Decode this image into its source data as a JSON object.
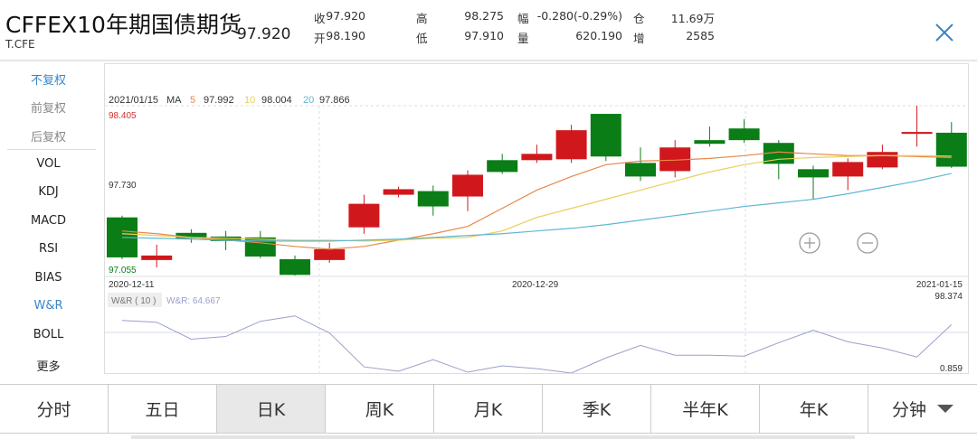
{
  "header": {
    "title": "CFFEX10年期国债期货",
    "code": "T.CFE",
    "last": "97.920",
    "quotes": [
      {
        "label": "收",
        "value": "97.920"
      },
      {
        "label": "高",
        "value": "98.275"
      },
      {
        "label": "幅",
        "value": "-0.280(-0.29%)"
      },
      {
        "label": "仓",
        "value": "11.69万"
      },
      {
        "label": "开",
        "value": "98.190"
      },
      {
        "label": "低",
        "value": "97.910"
      },
      {
        "label": "量",
        "value": "620.190"
      },
      {
        "label": "增",
        "value": "2585"
      }
    ]
  },
  "sidebar": {
    "items": [
      {
        "label": "不复权",
        "state": "active"
      },
      {
        "label": "前复权",
        "state": "gray"
      },
      {
        "label": "后复权",
        "state": "gray"
      },
      {
        "label": "VOL"
      },
      {
        "label": "KDJ"
      },
      {
        "label": "MACD"
      },
      {
        "label": "RSI"
      },
      {
        "label": "BIAS"
      },
      {
        "label": "W&R",
        "state": "active"
      },
      {
        "label": "BOLL"
      },
      {
        "label": "更多"
      }
    ]
  },
  "tabs": [
    {
      "label": "分时"
    },
    {
      "label": "五日"
    },
    {
      "label": "日K",
      "selected": true
    },
    {
      "label": "周K"
    },
    {
      "label": "月K"
    },
    {
      "label": "季K"
    },
    {
      "label": "半年K"
    },
    {
      "label": "年K"
    },
    {
      "label": "分钟",
      "dropdown": true
    }
  ],
  "colors": {
    "up": "#d0181c",
    "down": "#0b7d16",
    "ma5": "#e8884a",
    "ma10": "#e8cf5a",
    "ma20": "#5fb6d6",
    "wr": "#9aa0c8",
    "accent": "#3a86c8"
  },
  "chart_data": {
    "type": "candlestick",
    "legend": {
      "date": "2021/01/15",
      "ma_label": "MA",
      "ma5_label": "5",
      "ma5_value": "97.992",
      "ma10_label": "10",
      "ma10_value": "98.004",
      "ma20_label": "20",
      "ma20_value": "97.866"
    },
    "price_labels": {
      "max": "98.405",
      "mid": "97.730",
      "min": "97.055"
    },
    "ylim": [
      97.055,
      98.405
    ],
    "x_labels": [
      "2020-12-11",
      "2020-12-29",
      "2021-01-15"
    ],
    "candles": [
      [
        97.517,
        97.531,
        97.185,
        97.199
      ],
      [
        97.178,
        97.3,
        97.12,
        97.214
      ],
      [
        97.394,
        97.423,
        97.315,
        97.351
      ],
      [
        97.365,
        97.409,
        97.257,
        97.329
      ],
      [
        97.358,
        97.409,
        97.192,
        97.206
      ],
      [
        97.185,
        97.214,
        97.055,
        97.06
      ],
      [
        97.178,
        97.315,
        97.156,
        97.264
      ],
      [
        97.438,
        97.697,
        97.387,
        97.625
      ],
      [
        97.697,
        97.762,
        97.676,
        97.741
      ],
      [
        97.726,
        97.77,
        97.531,
        97.604
      ],
      [
        97.683,
        97.892,
        97.567,
        97.856
      ],
      [
        97.972,
        98.022,
        97.863,
        97.878
      ],
      [
        97.972,
        98.095,
        97.95,
        98.022
      ],
      [
        97.979,
        98.253,
        97.95,
        98.21
      ],
      [
        98.34,
        98.34,
        97.965,
        98.001
      ],
      [
        97.95,
        98.073,
        97.806,
        97.842
      ],
      [
        97.885,
        98.131,
        97.835,
        98.073
      ],
      [
        98.131,
        98.239,
        98.08,
        98.102
      ],
      [
        98.224,
        98.297,
        98.109,
        98.131
      ],
      [
        98.109,
        98.131,
        97.82,
        97.943
      ],
      [
        97.9,
        97.928,
        97.661,
        97.835
      ],
      [
        97.842,
        97.986,
        97.734,
        97.957
      ],
      [
        97.914,
        98.095,
        97.9,
        98.037
      ],
      [
        98.181,
        98.405,
        98.08,
        98.196
      ],
      [
        98.19,
        98.275,
        97.91,
        97.92
      ]
    ],
    "ma5": [
      97.409,
      97.387,
      97.358,
      97.336,
      97.315,
      97.286,
      97.264,
      97.286,
      97.336,
      97.387,
      97.445,
      97.589,
      97.734,
      97.842,
      97.936,
      97.965,
      97.972,
      97.986,
      98.008,
      98.037,
      98.022,
      98.008,
      98.008,
      98.001,
      97.992
    ],
    "ma10": [
      97.387,
      97.373,
      97.358,
      97.351,
      97.344,
      97.336,
      97.336,
      97.329,
      97.336,
      97.351,
      97.358,
      97.409,
      97.517,
      97.589,
      97.661,
      97.734,
      97.806,
      97.878,
      97.936,
      97.979,
      97.993,
      98.001,
      98.008,
      98.008,
      98.004
    ],
    "ma20": [
      97.358,
      97.351,
      97.344,
      97.336,
      97.329,
      97.329,
      97.329,
      97.336,
      97.344,
      97.358,
      97.373,
      97.387,
      97.409,
      97.43,
      97.459,
      97.495,
      97.531,
      97.567,
      97.604,
      97.632,
      97.661,
      97.705,
      97.755,
      97.806,
      97.866
    ],
    "indicator": {
      "name": "W&R ( 10 )",
      "value_label": "W&R: 64.667",
      "top_label": "98.374",
      "bottom_label": "0.859",
      "ylim": [
        0.859,
        98.374
      ],
      "values": [
        70.2,
        67.8,
        45.5,
        49.0,
        69.0,
        76.1,
        53.7,
        9.1,
        3.2,
        18.5,
        2.0,
        10.3,
        6.7,
        0.9,
        20.8,
        37.3,
        24.4,
        24.4,
        23.2,
        40.8,
        57.3,
        42.0,
        33.8,
        22.0,
        64.667
      ]
    }
  }
}
